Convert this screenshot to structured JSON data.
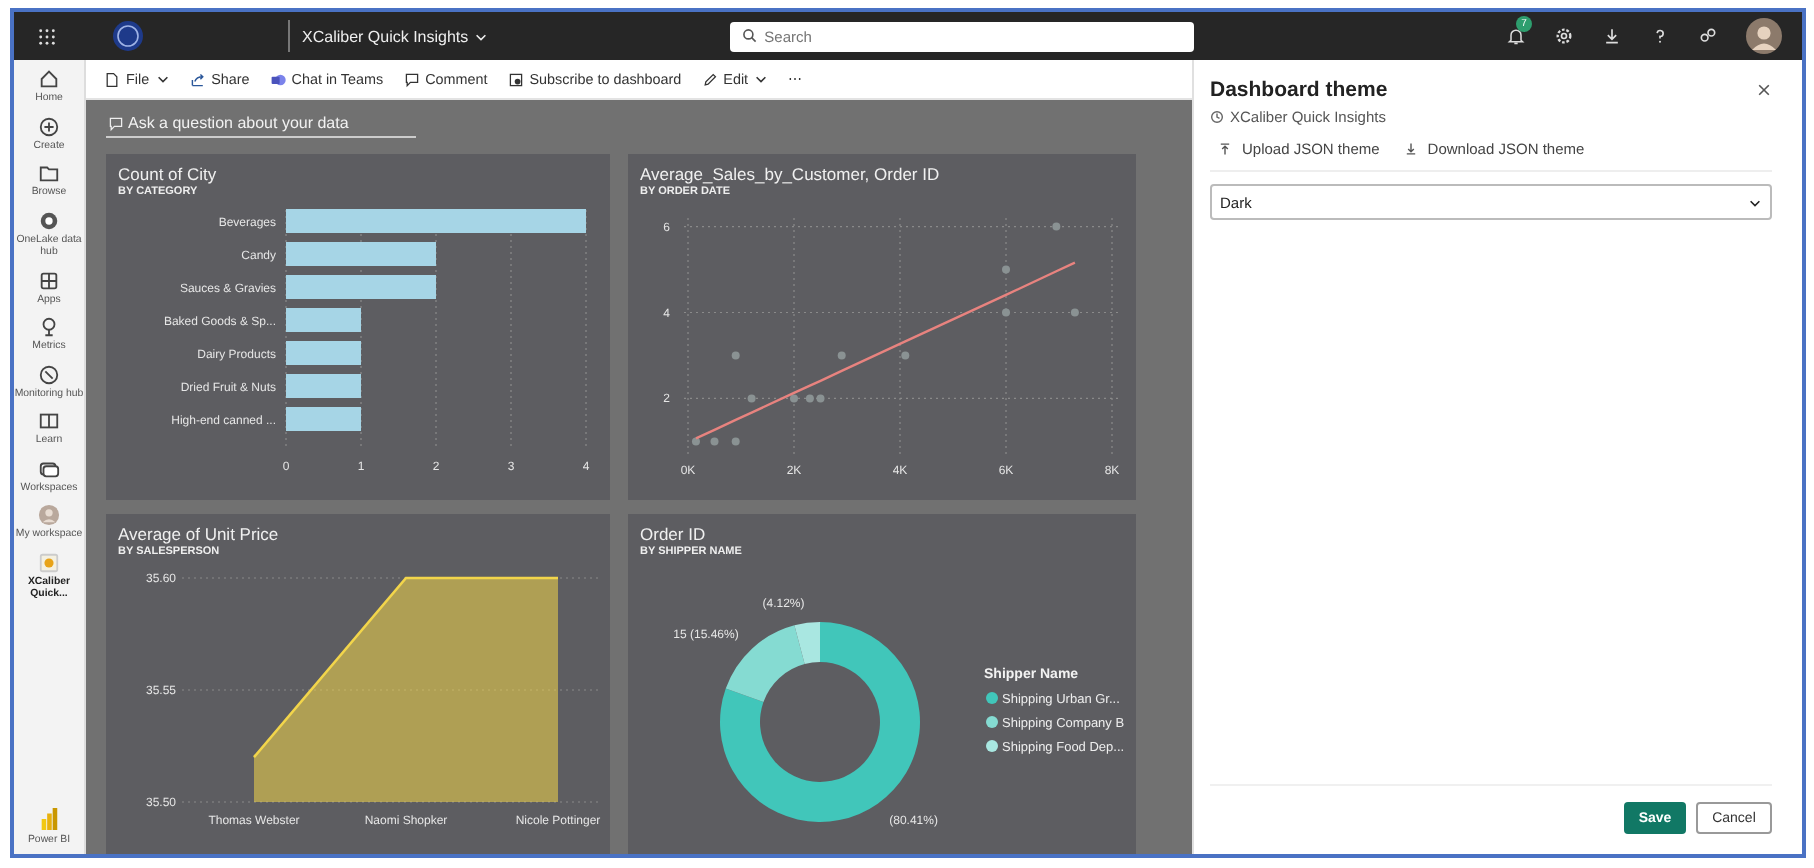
{
  "top_bar": {
    "app_name": "XCaliber Quick Insights",
    "search": {
      "placeholder": "Search"
    },
    "notification_count": "7"
  },
  "sidebar": {
    "items": [
      {
        "label": "Home",
        "selected": false
      },
      {
        "label": "Create",
        "selected": false
      },
      {
        "label": "Browse",
        "selected": false
      },
      {
        "label": "OneLake data hub",
        "selected": false
      },
      {
        "label": "Apps",
        "selected": false
      },
      {
        "label": "Metrics",
        "selected": false
      },
      {
        "label": "Monitoring hub",
        "selected": false
      },
      {
        "label": "Learn",
        "selected": false
      },
      {
        "label": "Workspaces",
        "selected": false
      },
      {
        "label": "My workspace",
        "selected": false
      },
      {
        "label": "XCaliber Quick...",
        "selected": true
      },
      {
        "label": "Power BI",
        "selected": false
      }
    ]
  },
  "toolbar": [
    {
      "label": "File",
      "dropdown": true
    },
    {
      "label": "Share",
      "dropdown": false
    },
    {
      "label": "Chat in Teams",
      "dropdown": false
    },
    {
      "label": "Comment",
      "dropdown": false
    },
    {
      "label": "Subscribe to dashboard",
      "dropdown": false
    },
    {
      "label": "Edit",
      "dropdown": true
    },
    {
      "label": "⋯",
      "dropdown": false
    }
  ],
  "qna": {
    "placeholder": "Ask a question about your data"
  },
  "tiles": [
    {
      "title": "Count of City",
      "subtitle": "BY CATEGORY",
      "chart_data": {
        "type": "bar",
        "orientation": "horizontal",
        "categories": [
          "Beverages",
          "Candy",
          "Sauces & Gravies",
          "Baked Goods & Sp...",
          "Dairy Products",
          "Dried Fruit & Nuts",
          "High-end canned ..."
        ],
        "series": [
          {
            "color": "#a6d5e6",
            "values": [
              4,
              2,
              2,
              1,
              1,
              1,
              1
            ]
          }
        ],
        "grid": true,
        "xlim": [
          0,
          4
        ],
        "xticks": [
          0,
          1,
          2,
          3,
          4
        ]
      }
    },
    {
      "title": "Average_Sales_by_Customer, Order ID",
      "subtitle": "BY ORDER DATE",
      "chart_data": {
        "type": "scatter",
        "x": [
          150,
          500,
          900,
          900,
          1200,
          2000,
          2300,
          2500,
          2900,
          4100,
          6000,
          6000,
          6950,
          7300
        ],
        "series": [
          {
            "type": "scatter",
            "color": "#8a9293",
            "values": [
              1,
              1,
              1,
              3,
              2,
              2,
              2,
              2,
              3,
              3,
              5,
              4,
              6,
              4
            ]
          },
          {
            "type": "line",
            "color": "#e8837f",
            "values": [
              1.07,
              1.27,
              1.5,
              1.5,
              1.67,
              2.13,
              2.3,
              2.41,
              2.64,
              3.33,
              4.41,
              4.41,
              4.96,
              5.16
            ]
          }
        ],
        "grid": true,
        "xlim": [
          0,
          8000
        ],
        "ylim": [
          0.8,
          6.2
        ],
        "xticks": [
          {
            "value": 0,
            "label": "0K"
          },
          {
            "value": 2000,
            "label": "2K"
          },
          {
            "value": 4000,
            "label": "4K"
          },
          {
            "value": 6000,
            "label": "6K"
          },
          {
            "value": 8000,
            "label": "8K"
          }
        ],
        "yticks": [
          2,
          4,
          6
        ]
      }
    },
    {
      "title": "Average of Unit Price",
      "subtitle": "BY SALESPERSON",
      "chart_data": {
        "type": "area",
        "categories": [
          "Thomas Webster",
          "Naomi Shopker",
          "Nicole Pottinger"
        ],
        "series": [
          {
            "color": "#f2d54b",
            "values": [
              35.52,
              35.6,
              35.6
            ]
          }
        ],
        "grid": true,
        "ylim": [
          35.5,
          35.6
        ],
        "yticks": [
          {
            "value": 35.5,
            "label": "35.50"
          },
          {
            "value": 35.55,
            "label": "35.55"
          },
          {
            "value": 35.6,
            "label": "35.60"
          }
        ]
      }
    },
    {
      "title": "Order ID",
      "subtitle": "BY SHIPPER NAME",
      "chart_data": {
        "type": "donut",
        "legend": {
          "title": "Shipper Name"
        },
        "categories": [
          "Shipping Urban Gr...",
          "Shipping Company B",
          "Shipping Food Dep..."
        ],
        "values": [
          80.41,
          15.46,
          4.12
        ],
        "colors": [
          "#41c6ba",
          "#85dbd2",
          "#a9e7e1"
        ],
        "value_labels": [
          "(80.41%)",
          "15 (15.46%)",
          "(4.12%)"
        ]
      }
    }
  ],
  "panel": {
    "title": "Dashboard theme",
    "subtitle": "XCaliber Quick Insights",
    "actions": [
      "Upload JSON theme",
      "Download JSON theme"
    ],
    "theme_select": {
      "value": "Dark"
    },
    "buttons": [
      "Save",
      "Cancel"
    ]
  }
}
